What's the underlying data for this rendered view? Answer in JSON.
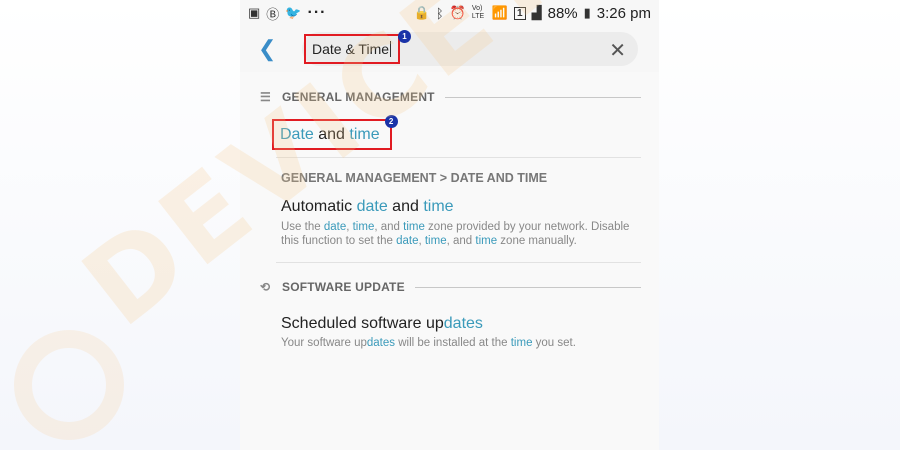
{
  "status_bar": {
    "battery": "88%",
    "time": "3:26 pm",
    "network": "LTE",
    "sim": "1",
    "volte": "Vo) LTE",
    "icons": [
      "image-icon",
      "b-icon",
      "twitter-icon",
      "more-dots-icon",
      "bluetooth-icon",
      "alarm-icon",
      "wifi-icon",
      "signal-icon",
      "battery-icon"
    ]
  },
  "search": {
    "query": "Date & Time",
    "badge": "1"
  },
  "sections": {
    "general_management": {
      "header": "GENERAL MANAGEMENT",
      "result": {
        "pre": "Date",
        "mid": " and ",
        "post": "time",
        "badge": "2"
      }
    },
    "date_time": {
      "breadcrumb": "GENERAL MANAGEMENT > DATE AND TIME",
      "title": {
        "a": "Automatic ",
        "b": "date",
        "c": " and ",
        "d": "time"
      },
      "desc": {
        "a": "Use the ",
        "b": "date",
        "c": ", ",
        "d": "time",
        "e": ", and ",
        "f": "time",
        "g": " zone provided by your network. Disable this function to set the ",
        "h": "date",
        "i": ", ",
        "j": "time",
        "k": ", and ",
        "l": "time",
        "m": " zone manually."
      }
    },
    "software_update": {
      "header": "SOFTWARE UPDATE",
      "title": {
        "a": "Scheduled software up",
        "b": "dates",
        "c": "s"
      },
      "desc": {
        "a": "Your software up",
        "b": "dates",
        "c": " will be installed at the ",
        "d": "time",
        "e": " you set."
      }
    }
  },
  "watermark": "DEVICETRICKS",
  "colors": {
    "highlight": "#3a9aba",
    "callout": "#e11b22",
    "badge": "#1a33a8",
    "back": "#3a8dc8"
  }
}
